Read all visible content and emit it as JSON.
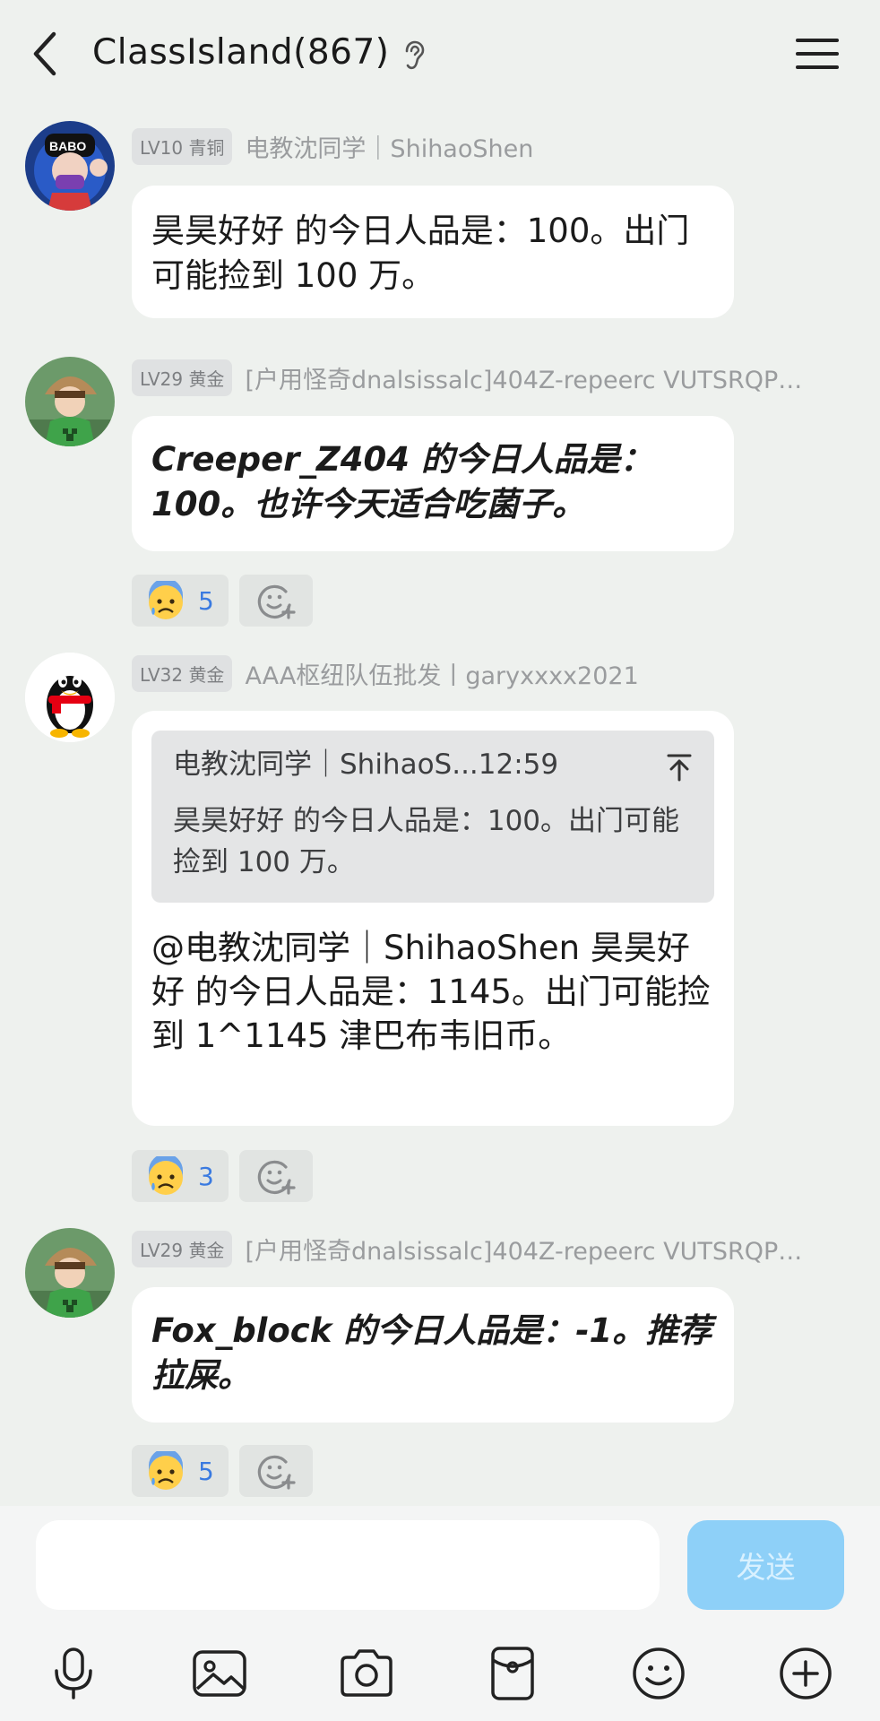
{
  "header": {
    "title": "ClassIsland(867)"
  },
  "messages": [
    {
      "level": "LV10",
      "rank": "青铜",
      "sender": "电教沈同学｜ShihaoShen",
      "text": "昊昊好好 的今日人品是：100。出门可能捡到 100 万。"
    },
    {
      "level": "LV29",
      "rank": "黄金",
      "sender": "[户用怪奇dnalsissalc]404Z-repeerc VUTSRQP…",
      "text": "Creeper_Z404 的今日人品是：100。也许今天适合吃菌子。",
      "reaction_count": "5"
    },
    {
      "level": "LV32",
      "rank": "黄金",
      "sender": "AAA枢纽队伍批发丨garyxxxx2021",
      "quote_head": "电教沈同学｜ShihaoS...12:59",
      "quote_text": "昊昊好好 的今日人品是：100。出门可能捡到 100 万。",
      "text": "@电教沈同学｜ShihaoShen 昊昊好好 的今日人品是：1145。出门可能捡到 1^1145 津巴布韦旧币。",
      "reaction_count": "3"
    },
    {
      "level": "LV29",
      "rank": "黄金",
      "sender": "[户用怪奇dnalsissalc]404Z-repeerc VUTSRQP…",
      "text": "Fox_block 的今日人品是：-1。推荐拉屎。",
      "reaction_count": "5"
    }
  ],
  "input": {
    "placeholder": "",
    "send_label": "发送"
  },
  "icons": {
    "back": "chevron-left-icon",
    "ear": "ear-icon",
    "menu": "menu-icon",
    "reaction": "anxious-face-icon",
    "add_reaction": "add-reaction-icon",
    "toolbar": [
      "microphone-icon",
      "image-icon",
      "camera-icon",
      "red-packet-icon",
      "emoji-icon",
      "plus-icon"
    ]
  },
  "colors": {
    "background": "#eef1ee",
    "send_button": "#8ed0f8",
    "reaction_count": "#3a7ae0"
  }
}
